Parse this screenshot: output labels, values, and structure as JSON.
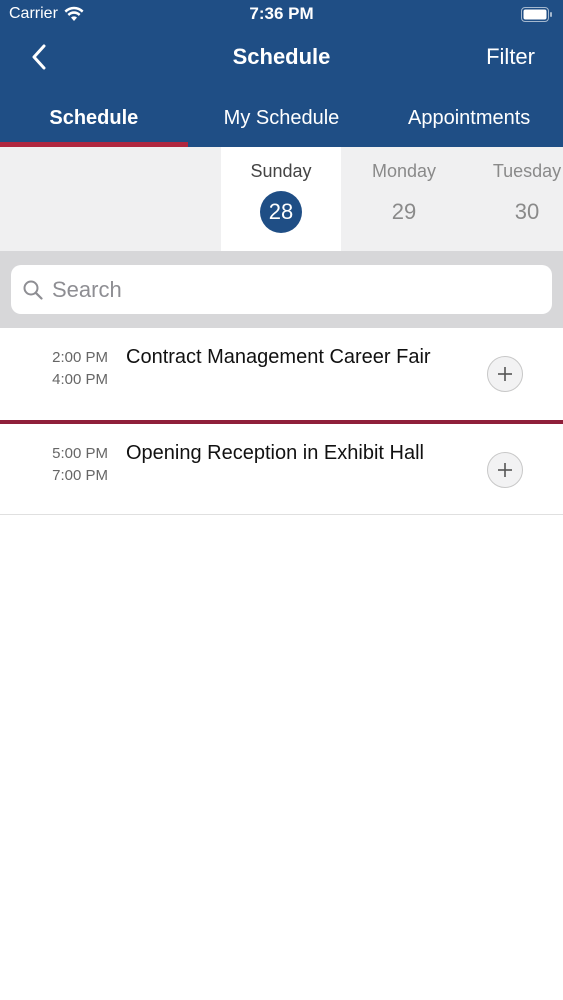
{
  "status_bar": {
    "carrier": "Carrier",
    "time": "7:36 PM"
  },
  "nav": {
    "title": "Schedule",
    "filter_label": "Filter"
  },
  "tabs": [
    {
      "label": "Schedule",
      "active": true
    },
    {
      "label": "My Schedule",
      "active": false
    },
    {
      "label": "Appointments",
      "active": false
    }
  ],
  "days": [
    {
      "name": "Sunday",
      "number": "28",
      "selected": true
    },
    {
      "name": "Monday",
      "number": "29",
      "selected": false
    },
    {
      "name": "Tuesday",
      "number": "30",
      "selected": false
    }
  ],
  "search": {
    "placeholder": "Search"
  },
  "events": [
    {
      "start": "2:00 PM",
      "end": "4:00 PM",
      "title": "Contract Management Career Fair"
    },
    {
      "start": "5:00 PM",
      "end": "7:00 PM",
      "title": "Opening Reception in Exhibit Hall"
    }
  ],
  "colors": {
    "header": "#1f4e85",
    "accent": "#b0273f",
    "row_divider": "#8f1f3a"
  },
  "icons": {
    "back": "chevron-left-icon",
    "search": "search-icon",
    "add": "plus-icon",
    "wifi": "wifi-icon",
    "battery": "battery-icon"
  }
}
